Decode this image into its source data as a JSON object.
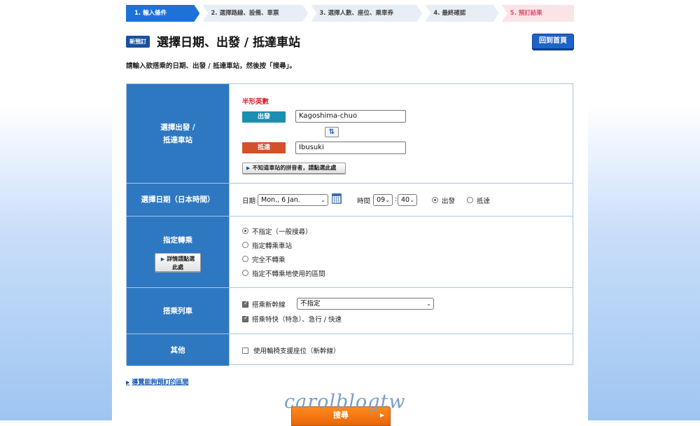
{
  "steps": [
    {
      "label": "1. 輸入條件"
    },
    {
      "label": "2. 選擇路線、設備、車票"
    },
    {
      "label": "3. 選擇人數、座位、乘車券"
    },
    {
      "label": "4. 最終確認"
    },
    {
      "label": "5. 預訂結果"
    }
  ],
  "header": {
    "badge": "新預訂",
    "title": "選擇日期、出發 / 抵達車站",
    "home_button": "回到首頁"
  },
  "instruction": "請輸入欲搭乘的日期、出發 / 抵達車站，然後按「搜尋」。",
  "station": {
    "label_line1": "選擇出發 /",
    "label_line2": "抵達車站",
    "halfwidth_note": "半形英數",
    "departure_label": "出發",
    "departure_value": "Kagoshima-chuo",
    "swap_symbol": "⇅",
    "arrival_label": "抵達",
    "arrival_value": "Ibusuki",
    "romaji_help": "不知道車站的拼音者，請點選此處"
  },
  "date": {
    "label": "選擇日期（日本時間）",
    "date_label": "日期",
    "date_value": "Mon., 6 Jan.",
    "time_label": "時間",
    "hour": "09",
    "colon": ":",
    "minute": "40",
    "mode_departure": "出發",
    "mode_arrival": "抵達",
    "selected_mode": "出發"
  },
  "transfer": {
    "label": "指定轉乘",
    "detail_line1": "詳情請點選",
    "detail_line2": "此處",
    "options": [
      "不指定（一般搜尋）",
      "指定轉乘車站",
      "完全不轉乘",
      "指定不轉乘地使用的區間"
    ],
    "selected": "不指定（一般搜尋）"
  },
  "trains": {
    "label": "搭乘列車",
    "shinkansen_label": "搭乘新幹線",
    "shinkansen_checked": true,
    "shinkansen_select": "不指定",
    "limited_label": "搭乘特快（特急）、急行 / 快速",
    "limited_checked": true
  },
  "other": {
    "label": "其他",
    "wheelchair_label": "使用輪椅支援座位（新幹線）",
    "wheelchair_checked": false
  },
  "bottom": {
    "link": "導覽能夠預訂的區間",
    "watermark": "carolblogtw",
    "search_button": "搜尋"
  }
}
